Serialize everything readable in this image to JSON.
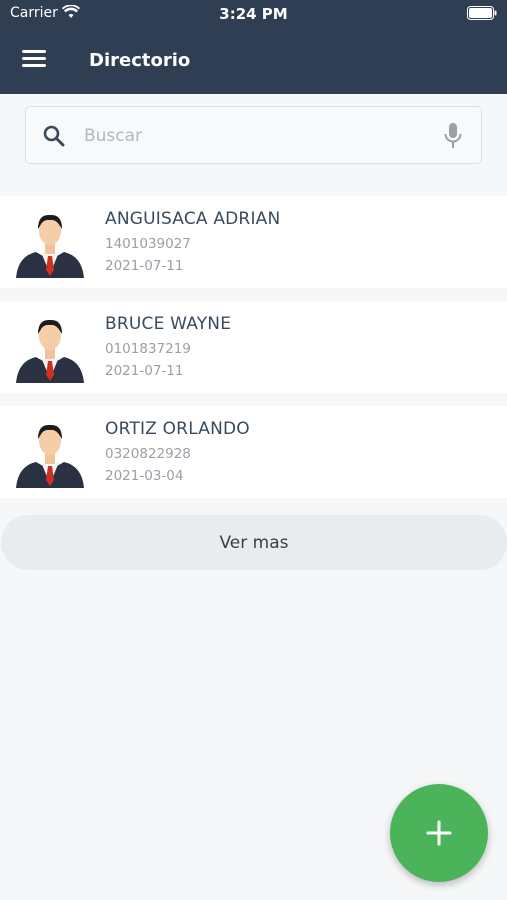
{
  "status_bar": {
    "carrier": "Carrier",
    "time": "3:24 PM"
  },
  "header": {
    "title": "Directorio",
    "menu_icon": "hamburger-menu-icon"
  },
  "search": {
    "placeholder": "Buscar",
    "value": ""
  },
  "contacts": [
    {
      "name": "ANGUISACA ADRIAN",
      "id_number": "1401039027",
      "date": "2021-07-11"
    },
    {
      "name": "BRUCE WAYNE",
      "id_number": "0101837219",
      "date": "2021-07-11"
    },
    {
      "name": "ORTIZ ORLANDO",
      "id_number": "0320822928",
      "date": "2021-03-04"
    }
  ],
  "actions": {
    "more_label": "Ver mas",
    "add_icon": "plus-icon"
  },
  "colors": {
    "header": "#2f3e52",
    "fab": "#4bb45b",
    "name_text": "#3a4a5e",
    "secondary_text": "#9aa0a8"
  }
}
